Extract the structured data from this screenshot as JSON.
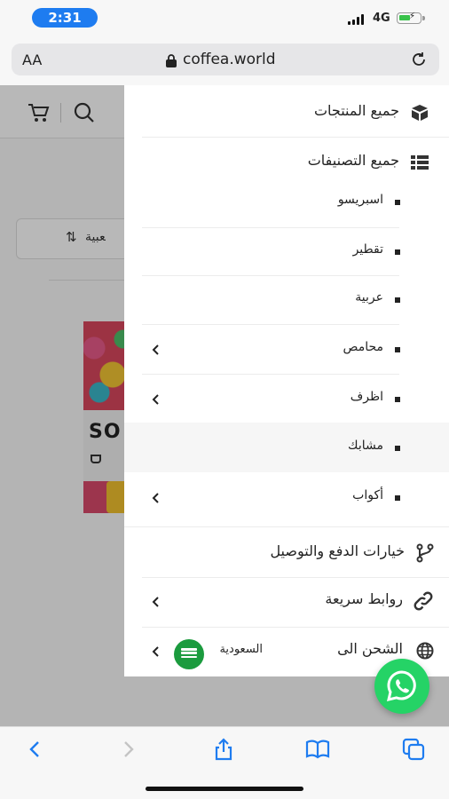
{
  "status_bar": {
    "time": "2:31",
    "network": "4G",
    "time_color": "#1e7cf0"
  },
  "browser": {
    "text_size_label": "AA",
    "url": "coffea.world"
  },
  "background_page": {
    "sort_label": "ﻌﺒﻴﺔ",
    "product_brand": "SO"
  },
  "menu": {
    "all_products": "جميع المنتجات",
    "all_categories": "جميع التصنيفات",
    "subcategories": [
      {
        "label": "اسبريسو",
        "has_children": false
      },
      {
        "label": "تقطير",
        "has_children": false
      },
      {
        "label": "عربية",
        "has_children": false
      },
      {
        "label": "محامص",
        "has_children": true
      },
      {
        "label": "اظرف",
        "has_children": true
      },
      {
        "label": "مشابك",
        "has_children": false
      },
      {
        "label": "أكواب",
        "has_children": true
      }
    ],
    "payment_shipping": "خيارات الدفع والتوصيل",
    "quick_links": "روابط سريعة",
    "ship_to_label": "الشحن الى",
    "ship_to_country": "السعودية"
  },
  "colors": {
    "whatsapp": "#25d366",
    "browser_accent": "#1e7cf0",
    "flag": "#1b9b3e"
  },
  "icons": [
    "box-icon",
    "list-icon",
    "split-icon",
    "link-icon",
    "globe-icon",
    "cart-icon",
    "search-icon",
    "whatsapp-icon",
    "back-icon",
    "forward-icon",
    "share-icon",
    "bookmarks-icon",
    "tabs-icon",
    "lock-icon",
    "reload-icon"
  ]
}
